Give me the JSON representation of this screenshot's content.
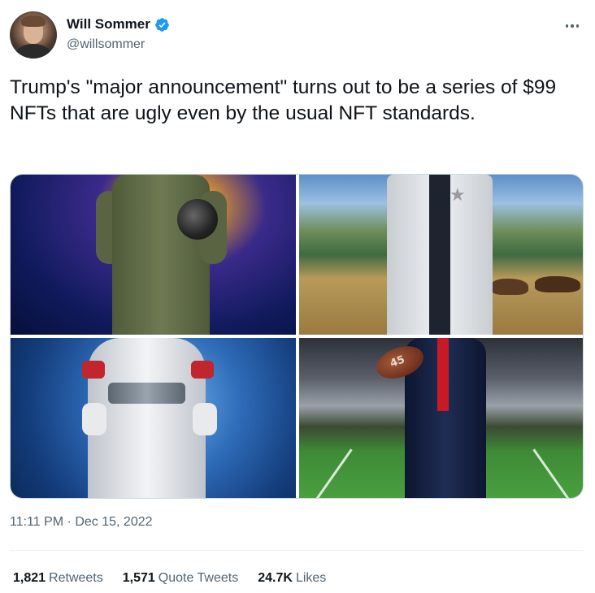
{
  "author": {
    "display_name": "Will Sommer",
    "handle": "@willsommer",
    "verified": true
  },
  "tweet": {
    "text": "Trump's \"major announcement\" turns out to be a series of $99 NFTs that are ugly even by the usual NFT standards."
  },
  "media": {
    "images": [
      {
        "description_icon": "pilot-image"
      },
      {
        "description_icon": "sheriff-image"
      },
      {
        "description_icon": "astronaut-image"
      },
      {
        "description_icon": "football-image",
        "ball_label": "45"
      }
    ]
  },
  "meta": {
    "timestamp": "11:11 PM · Dec 15, 2022"
  },
  "stats": [
    {
      "count": "1,821",
      "label": "Retweets"
    },
    {
      "count": "1,571",
      "label": "Quote Tweets"
    },
    {
      "count": "24.7K",
      "label": "Likes"
    }
  ],
  "colors": {
    "text_primary": "#0f1419",
    "text_secondary": "#536471",
    "verified_blue": "#1d9bf0",
    "border": "#cfd9de"
  }
}
